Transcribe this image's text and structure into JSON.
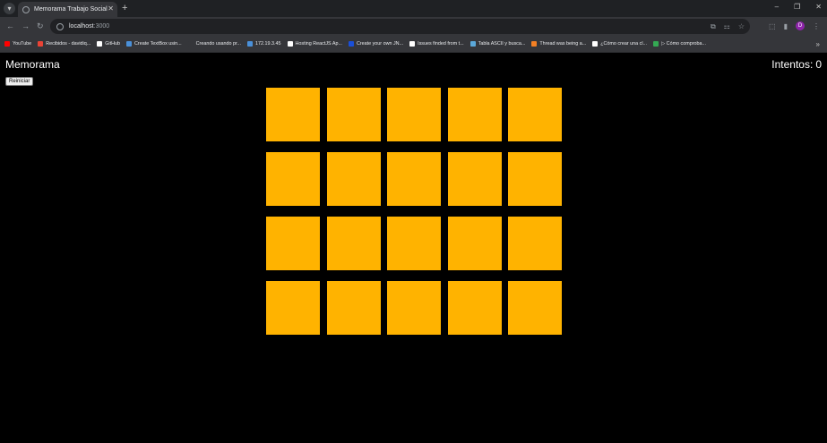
{
  "browser": {
    "tab_title": "Memorama Trabajo Social",
    "url_host": "localhost",
    "url_port": ":3000",
    "profile_initial": "D",
    "bookmarks": [
      {
        "label": "YouTube",
        "icon": "youtube-icon",
        "color": "#ff0000"
      },
      {
        "label": "Recibidos - davidiq...",
        "icon": "gmail-icon",
        "color": "#ea4335"
      },
      {
        "label": "GitHub",
        "icon": "github-icon",
        "color": "#ffffff"
      },
      {
        "label": "Create TextBox usin...",
        "icon": "tt-icon",
        "color": "#4a90d9"
      },
      {
        "label": "Creando usando pr...",
        "icon": "blank-icon",
        "color": "#35363a"
      },
      {
        "label": "172.19.3.45",
        "icon": "globe-icon",
        "color": "#4a90d9"
      },
      {
        "label": "Hosting ReactJS Ap...",
        "icon": "link-icon",
        "color": "#ffffff"
      },
      {
        "label": "Create your own JN...",
        "icon": "b-icon",
        "color": "#1a4fd8"
      },
      {
        "label": "Issues finded from t...",
        "icon": "issue-icon",
        "color": "#ffffff"
      },
      {
        "label": "Tabla ASCII y busca...",
        "icon": "m-icon",
        "color": "#5ba8d9"
      },
      {
        "label": "Thread was being a...",
        "icon": "so-icon",
        "color": "#f48024"
      },
      {
        "label": "¿Cómo crear una cl...",
        "icon": "bars-icon",
        "color": "#ffffff"
      },
      {
        "label": "▷ Cómo comproba...",
        "icon": "drive-icon",
        "color": "#34a853"
      }
    ]
  },
  "app": {
    "title": "Memorama",
    "attempts_label": "Intentos:",
    "attempts_value": "0",
    "reset_label": "Reiniciar",
    "card_color": "#ffb300",
    "card_count": 20
  }
}
